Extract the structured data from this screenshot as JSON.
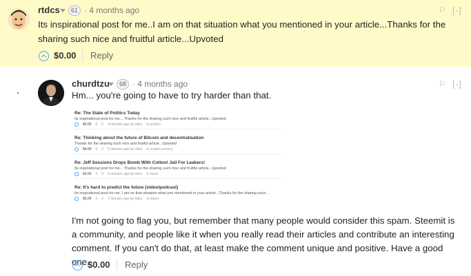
{
  "comment1": {
    "author": "rtdcs",
    "reputation": "61",
    "time": "· 4 months ago",
    "flag_glyph": "⚐",
    "collapse": "[-]",
    "body": "Its inspirational post for me..I am on that situation what you mentioned in your article...Thanks for the sharing such nice and fruitful article...Upvoted",
    "payout": "$0.00",
    "reply": "Reply"
  },
  "comment2": {
    "author": "churdtzu",
    "reputation": "68",
    "time": "· 4 months ago",
    "flag_glyph": "⚐",
    "collapse": "[-]",
    "intro": "Hm... you're going to have to try harder than that.",
    "body": "I'm not going to flag you, but remember that many people would consider this spam. Steemit is a community, and people like it when you really read their articles and contribute an interesting comment. If you can't do that, at least make the comment unique and positive. Have a good one.",
    "payout": "$0.00",
    "reply": "Reply"
  },
  "embed": {
    "entries": [
      {
        "title": "Re: The State of Politics Today",
        "body": "Its inspirational post for me... Thanks for the sharing such nice and fruitful article...Upvoted",
        "payout": "$0.00",
        "votes": "0",
        "comments": "0",
        "time": "4 minutes ago by rtdcs",
        "in": "in politics"
      },
      {
        "title": "Re: Thinking about the future of Bitcoin and decentralisation",
        "body": "Thanks for the sharing such nice and fruitful article...Upvoted",
        "payout": "$0.00",
        "votes": "0",
        "comments": "0",
        "time": "5 minutes ago by rtdcs",
        "in": "in cryptocurrency"
      },
      {
        "title": "Re: Jeff Sessions Drops Bomb With Cotton! Jail For Leakers!",
        "body": "Its inspirational post for me... Thanks for the sharing such nice and fruitful article...Upvoted",
        "payout": "$0.00",
        "votes": "0",
        "comments": "0",
        "time": "6 minutes ago by rtdcs",
        "in": "in news"
      },
      {
        "title": "Re: It's hard to predict the future (video/podcast)",
        "body": "Its inspirational post for me. I am on that situation what you mentioned in your article...Thanks for the sharing such...",
        "payout": "$0.00",
        "votes": "0",
        "comments": "0",
        "time": "7 minutes ago by rtdcs",
        "in": "in future"
      }
    ]
  },
  "icons": {
    "upvote": "upvote-icon",
    "flag": "flag-icon",
    "dropdown": "chevron-down-icon"
  },
  "colors": {
    "highlight_bg": "#fffbc9",
    "accent": "#4ba2f2"
  }
}
